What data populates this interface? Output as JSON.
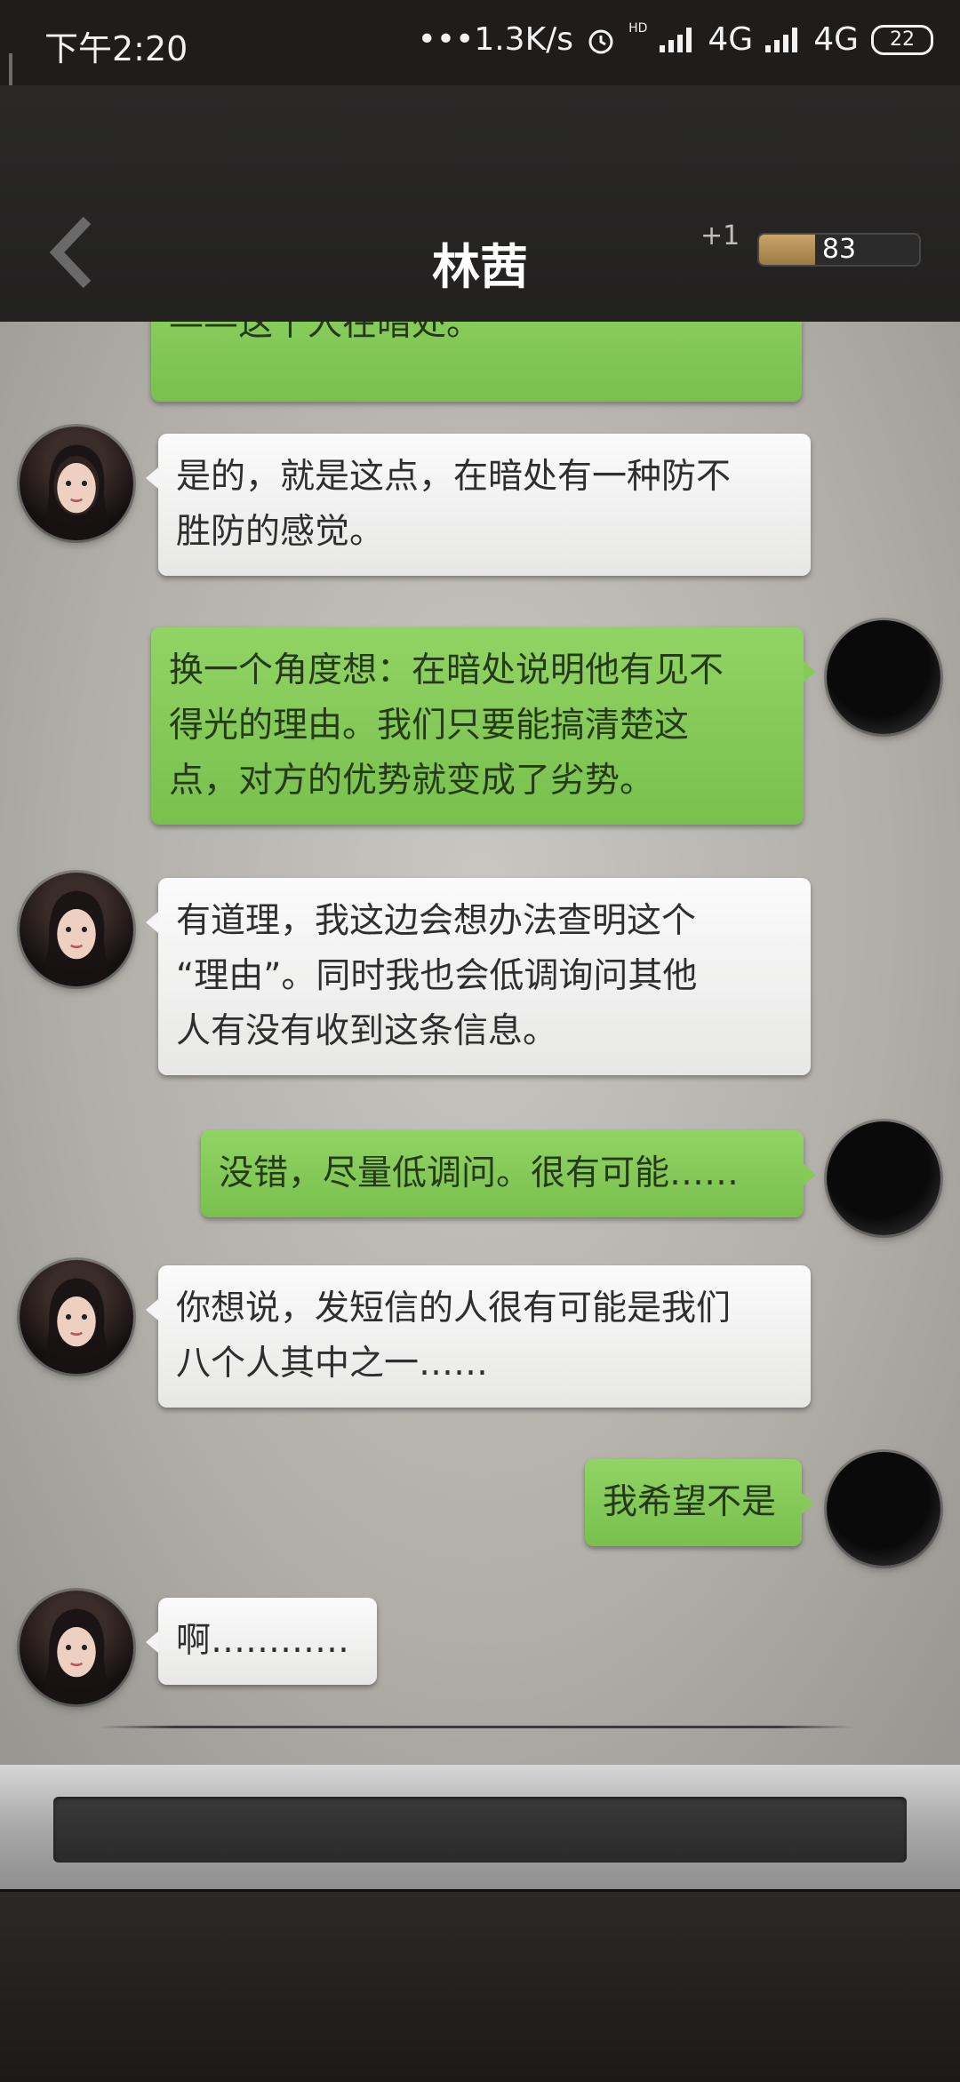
{
  "status_bar": {
    "time": "下午2:20",
    "network_speed": "•••1.3K/s",
    "alarm_icon": "alarm-icon",
    "hd_label": "HD",
    "carrier_1": "4G",
    "carrier_2": "4G",
    "battery": "22"
  },
  "header": {
    "title": "林茜",
    "plus": "+1",
    "progress_value": "83",
    "progress_fraction": 0.35,
    "back_icon": "chevron-left-icon"
  },
  "messages": [
    {
      "side": "right",
      "text": "——这个人在暗处。"
    },
    {
      "side": "left",
      "text": "是的，就是这点，在暗处有一种防不\n胜防的感觉。"
    },
    {
      "side": "right",
      "text": "换一个角度想：在暗处说明他有见不\n得光的理由。我们只要能搞清楚这\n点，对方的优势就变成了劣势。"
    },
    {
      "side": "left",
      "text": "有道理，我这边会想办法查明这个\n“理由”。同时我也会低调询问其他\n人有没有收到这条信息。"
    },
    {
      "side": "right",
      "text": "没错，尽量低调问。很有可能……"
    },
    {
      "side": "left",
      "text": "你想说，发短信的人很有可能是我们\n八个人其中之一……"
    },
    {
      "side": "right",
      "text": "我希望不是"
    },
    {
      "side": "left",
      "text": "啊…………"
    }
  ],
  "input": {
    "value": ""
  },
  "colors": {
    "green_bubble": "#86cb58",
    "white_bubble": "#f3f3f3",
    "header": "#242322"
  }
}
